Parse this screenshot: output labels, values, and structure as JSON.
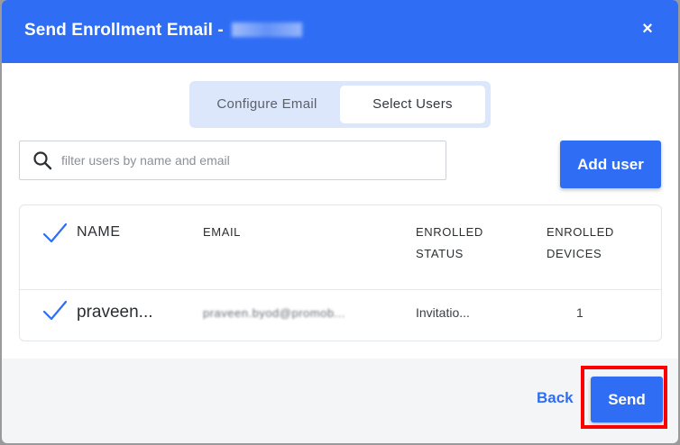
{
  "dialog": {
    "title": "Send Enrollment Email - ",
    "title_suffix_redacted": "WWQSSY",
    "close_label": "×"
  },
  "tabs": [
    {
      "label": "Configure Email",
      "active": false
    },
    {
      "label": "Select Users",
      "active": true
    }
  ],
  "search": {
    "placeholder": "filter users by name and email",
    "value": ""
  },
  "add_user_label": "Add user",
  "table": {
    "headers": {
      "name": "NAME",
      "email": "EMAIL",
      "status_line1": "ENROLLED",
      "status_line2": "STATUS",
      "devices_line1": "ENROLLED",
      "devices_line2": "DEVICES"
    },
    "rows": [
      {
        "selected": true,
        "name": "praveen...",
        "email": "praveen.byod@promob...",
        "status": "Invitatio...",
        "devices": "1"
      }
    ]
  },
  "footer": {
    "back_label": "Back",
    "send_label": "Send"
  },
  "colors": {
    "primary": "#2f6df5",
    "highlight": "#ff0000"
  }
}
